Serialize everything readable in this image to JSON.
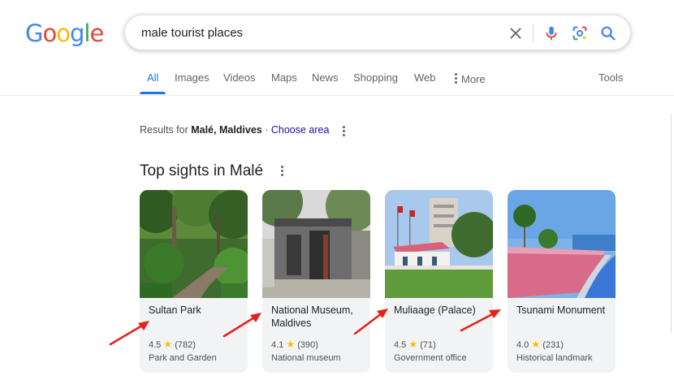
{
  "logo": {
    "text": "Google",
    "letters": [
      "G",
      "o",
      "o",
      "g",
      "l",
      "e"
    ],
    "colors": [
      "#4285f4",
      "#ea4335",
      "#fbbc05",
      "#4285f4",
      "#34a853",
      "#ea4335"
    ]
  },
  "search": {
    "query": "male tourist places"
  },
  "tabs": [
    {
      "label": "All",
      "active": true
    },
    {
      "label": "Images"
    },
    {
      "label": "Videos"
    },
    {
      "label": "Maps"
    },
    {
      "label": "News"
    },
    {
      "label": "Shopping"
    },
    {
      "label": "Web"
    },
    {
      "label": "More",
      "icon": "vertical-dots-icon"
    }
  ],
  "tools_label": "Tools",
  "results_for": {
    "prefix": "Results for ",
    "place": "Malé, Maldives",
    "separator": " · ",
    "link": "Choose area"
  },
  "section_title": "Top sights in Malé",
  "sights": [
    {
      "name": "Sultan Park",
      "rating": "4.5",
      "reviews": "(782)",
      "type": "Park and Garden"
    },
    {
      "name": "National Museum, Maldives",
      "rating": "4.1",
      "reviews": "(390)",
      "type": "National museum"
    },
    {
      "name": "Muliaage (Palace)",
      "rating": "4.5",
      "reviews": "(71)",
      "type": "Government office"
    },
    {
      "name": "Tsunami Monument",
      "rating": "4.0",
      "reviews": "(231)",
      "type": "Historical landmark"
    }
  ],
  "colors": {
    "accent": "#1a73e8",
    "annotation_arrow": "#e8201a",
    "star": "#fbbc04"
  }
}
